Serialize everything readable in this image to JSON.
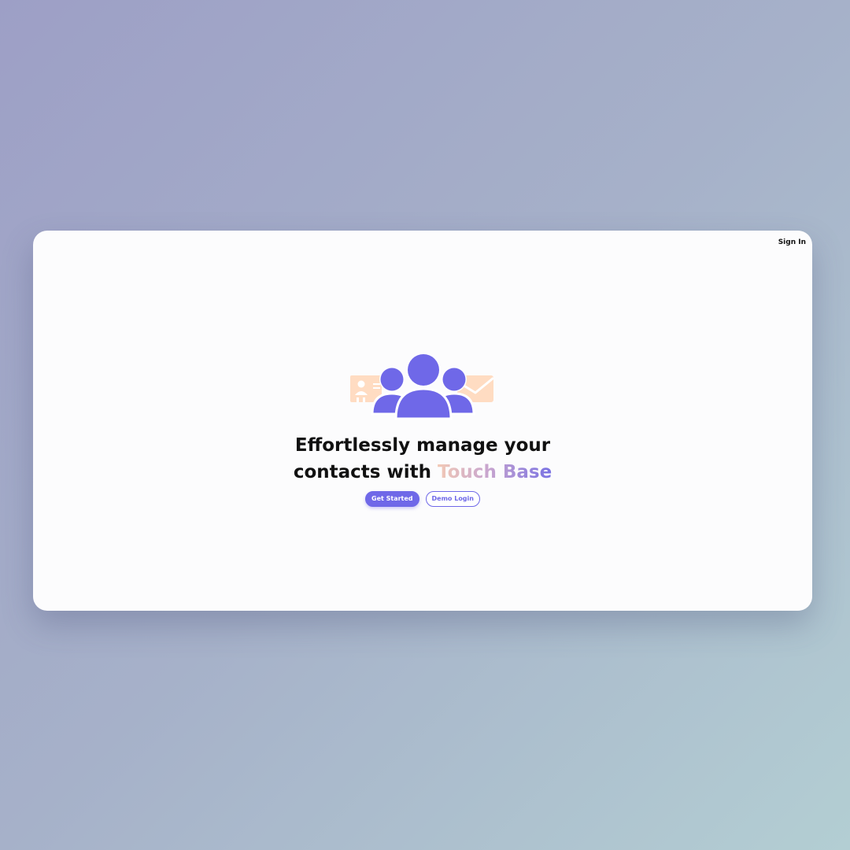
{
  "nav": {
    "sign_in_label": "Sign In"
  },
  "hero": {
    "heading_prefix": "Effortlessly manage your contacts with ",
    "brand_name": "Touch Base",
    "primary_cta_label": "Get Started",
    "secondary_cta_label": "Demo Login"
  },
  "illustration": {
    "icons": [
      "contact-card-icon",
      "users-group-icon",
      "envelope-icon"
    ]
  },
  "colors": {
    "accent": "#6f68e8",
    "accent_light": "#ffdcc2",
    "brand_gradient_start": "#f2c9b6",
    "brand_gradient_end": "#7a72e3",
    "window_background": "#fcfcfd",
    "text": "#111111"
  }
}
